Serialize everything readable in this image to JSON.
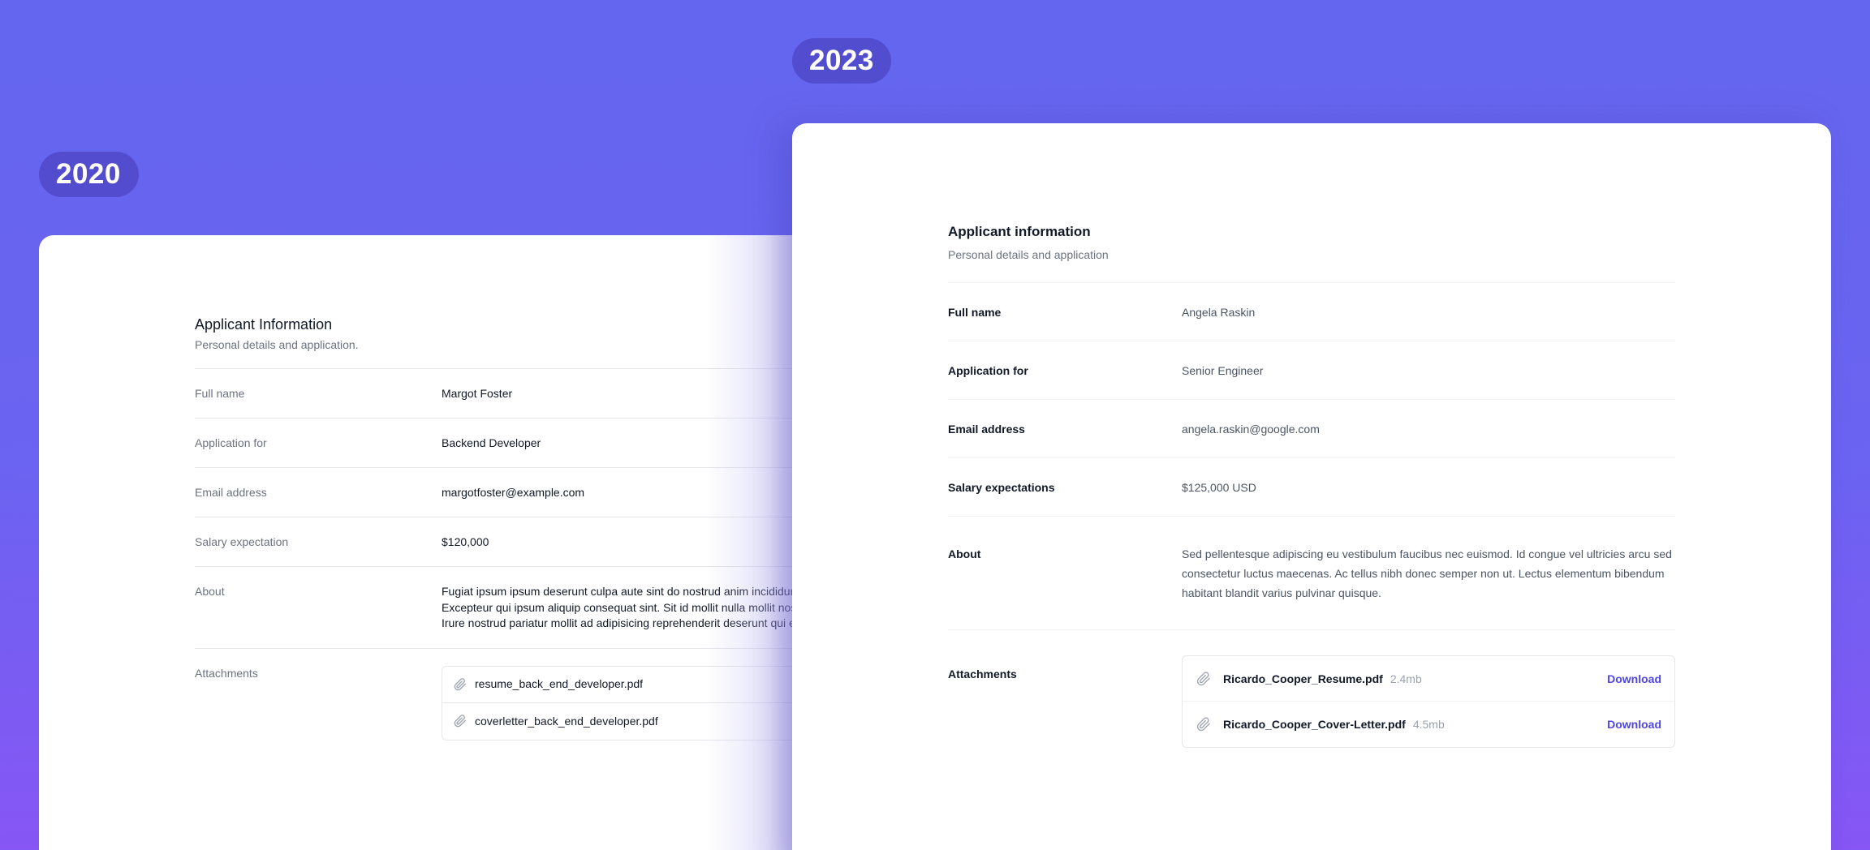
{
  "badges": {
    "old_year": "2020",
    "new_year": "2023"
  },
  "old_card": {
    "title": "Applicant Information",
    "subtitle": "Personal details and application.",
    "fields": [
      {
        "label": "Full name",
        "value": "Margot Foster"
      },
      {
        "label": "Application for",
        "value": "Backend Developer"
      },
      {
        "label": "Email address",
        "value": "margotfoster@example.com"
      },
      {
        "label": "Salary expectation",
        "value": "$120,000"
      },
      {
        "label": "About",
        "value": "Fugiat ipsum ipsum deserunt culpa aute sint do nostrud anim incididunt cillum culpa consequat. Excepteur qui ipsum aliquip consequat sint. Sit id mollit nulla mollit nostrud in ea officia proident. Irure nostrud pariatur mollit ad adipisicing reprehenderit deserunt qui eu."
      }
    ],
    "attachments_label": "Attachments",
    "attachments": [
      {
        "name": "resume_back_end_developer.pdf"
      },
      {
        "name": "coverletter_back_end_developer.pdf"
      }
    ]
  },
  "new_card": {
    "title": "Applicant information",
    "subtitle": "Personal details and application",
    "fields": [
      {
        "label": "Full name",
        "value": "Angela Raskin"
      },
      {
        "label": "Application for",
        "value": "Senior Engineer"
      },
      {
        "label": "Email address",
        "value": "angela.raskin@google.com"
      },
      {
        "label": "Salary expectations",
        "value": "$125,000 USD"
      },
      {
        "label": "About",
        "value": "Sed pellentesque adipiscing eu vestibulum faucibus nec euismod. Id congue vel ultricies arcu sed consectetur luctus maecenas. Ac tellus nibh donec semper non ut. Lectus elementum bibendum habitant blandit varius pulvinar quisque."
      }
    ],
    "attachments_label": "Attachments",
    "attachments": [
      {
        "name": "Ricardo_Cooper_Resume.pdf",
        "size": "2.4mb",
        "action": "Download"
      },
      {
        "name": "Ricardo_Cooper_Cover-Letter.pdf",
        "size": "4.5mb",
        "action": "Download"
      }
    ]
  },
  "colors": {
    "accent": "#4f46e5",
    "background_top": "#6466ef",
    "background_bottom": "#8756f4"
  },
  "icons": {
    "attachment": "paperclip-icon"
  }
}
